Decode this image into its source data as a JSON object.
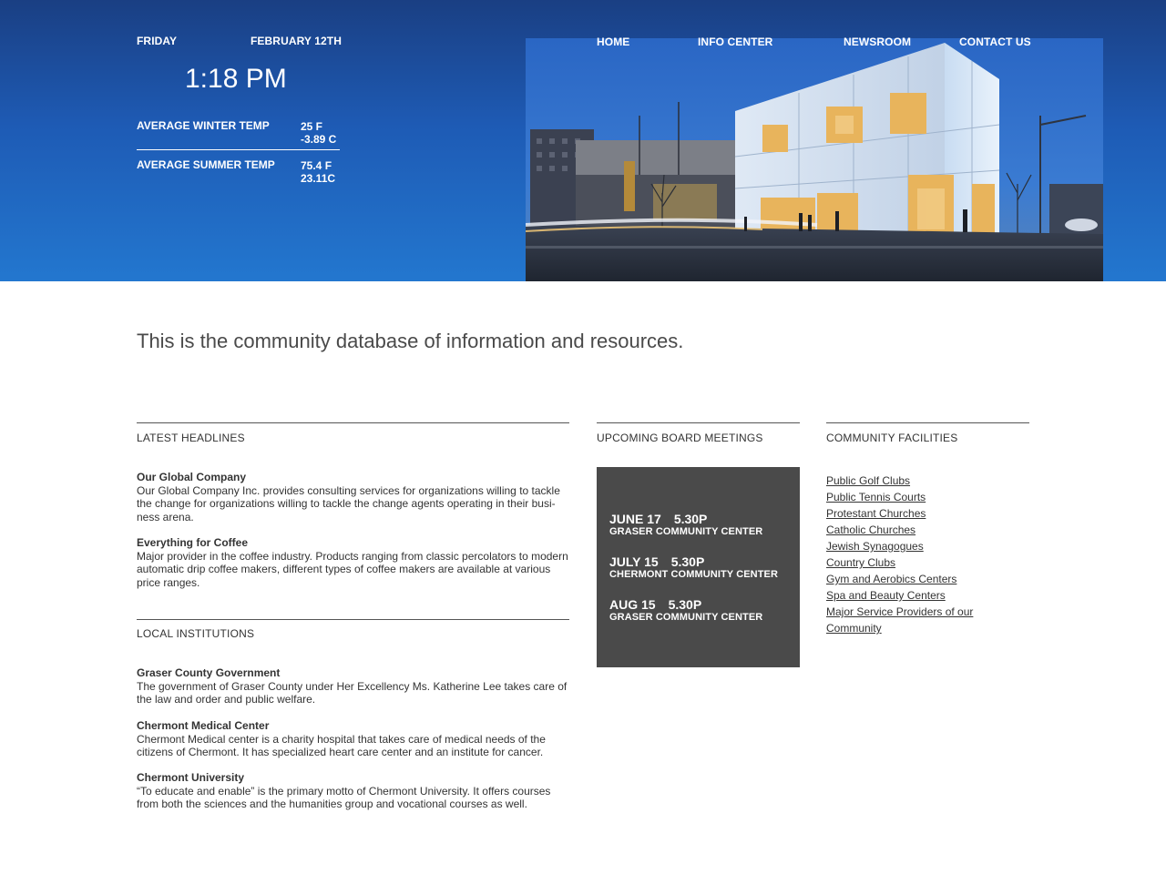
{
  "header": {
    "day": "FRIDAY",
    "date": "FEBRUARY 12TH",
    "time": "1:18 PM",
    "winter": {
      "label": "AVERAGE WINTER TEMP",
      "f": "25 F",
      "c": "-3.89 C"
    },
    "summer": {
      "label": "AVERAGE SUMMER TEMP",
      "f": "75.4 F",
      "c": "23.11C"
    }
  },
  "nav": {
    "items": [
      "HOME",
      "INFO CENTER",
      "NEWSROOM",
      "CONTACT US"
    ]
  },
  "intro": "This is the community database of information and resources.",
  "headlines": {
    "title": "LATEST HEADLINES",
    "items": [
      {
        "title": "Our Global Company",
        "body": "Our Global Company Inc. provides consulting services for organizations willing to tackle the change for organizations willing to tackle the change agents operating in their busi-ness arena."
      },
      {
        "title": "Everything for Coffee",
        "body": "Major provider in the coffee industry. Products ranging from classic percolators to modern automatic drip coffee makers, different types of coffee makers are available at various price ranges."
      }
    ]
  },
  "institutions": {
    "title": "LOCAL INSTITUTIONS",
    "items": [
      {
        "title": "Graser County Government",
        "body": "The government of Graser County under Her Excellency Ms. Katherine Lee takes care of the law and order and public welfare."
      },
      {
        "title": "Chermont Medical Center",
        "body": "Chermont Medical center is a charity hospital that takes care of medical needs of the citizens of Chermont. It has specialized heart care center and an institute for cancer."
      },
      {
        "title": "Chermont University",
        "body": "“To educate and enable” is the primary motto of Chermont University. It offers courses from both the sciences and the humanities group and vocational courses as well."
      }
    ]
  },
  "meetings": {
    "title": "UPCOMING BOARD MEETINGS",
    "items": [
      {
        "date": "JUNE 17",
        "time": "5.30P",
        "location": "GRASER COMMUNITY CENTER"
      },
      {
        "date": "JULY 15",
        "time": "5.30P",
        "location": "CHERMONT COMMUNITY CENTER"
      },
      {
        "date": "AUG 15",
        "time": "5.30P",
        "location": "GRASER COMMUNITY CENTER"
      }
    ]
  },
  "facilities": {
    "title": "COMMUNITY FACILITIES",
    "items": [
      "Public Golf Clubs",
      "Public Tennis Courts",
      "Protestant Churches",
      "Catholic Churches",
      "Jewish Synagogues",
      "Country Clubs",
      "Gym and Aerobics Centers",
      "Spa and Beauty Centers",
      "Major Service Providers of our Community"
    ]
  },
  "colors": {
    "header_top": "#1a3f83",
    "header_bottom": "#2377cf",
    "meetings_bg": "#4a4a4a"
  }
}
